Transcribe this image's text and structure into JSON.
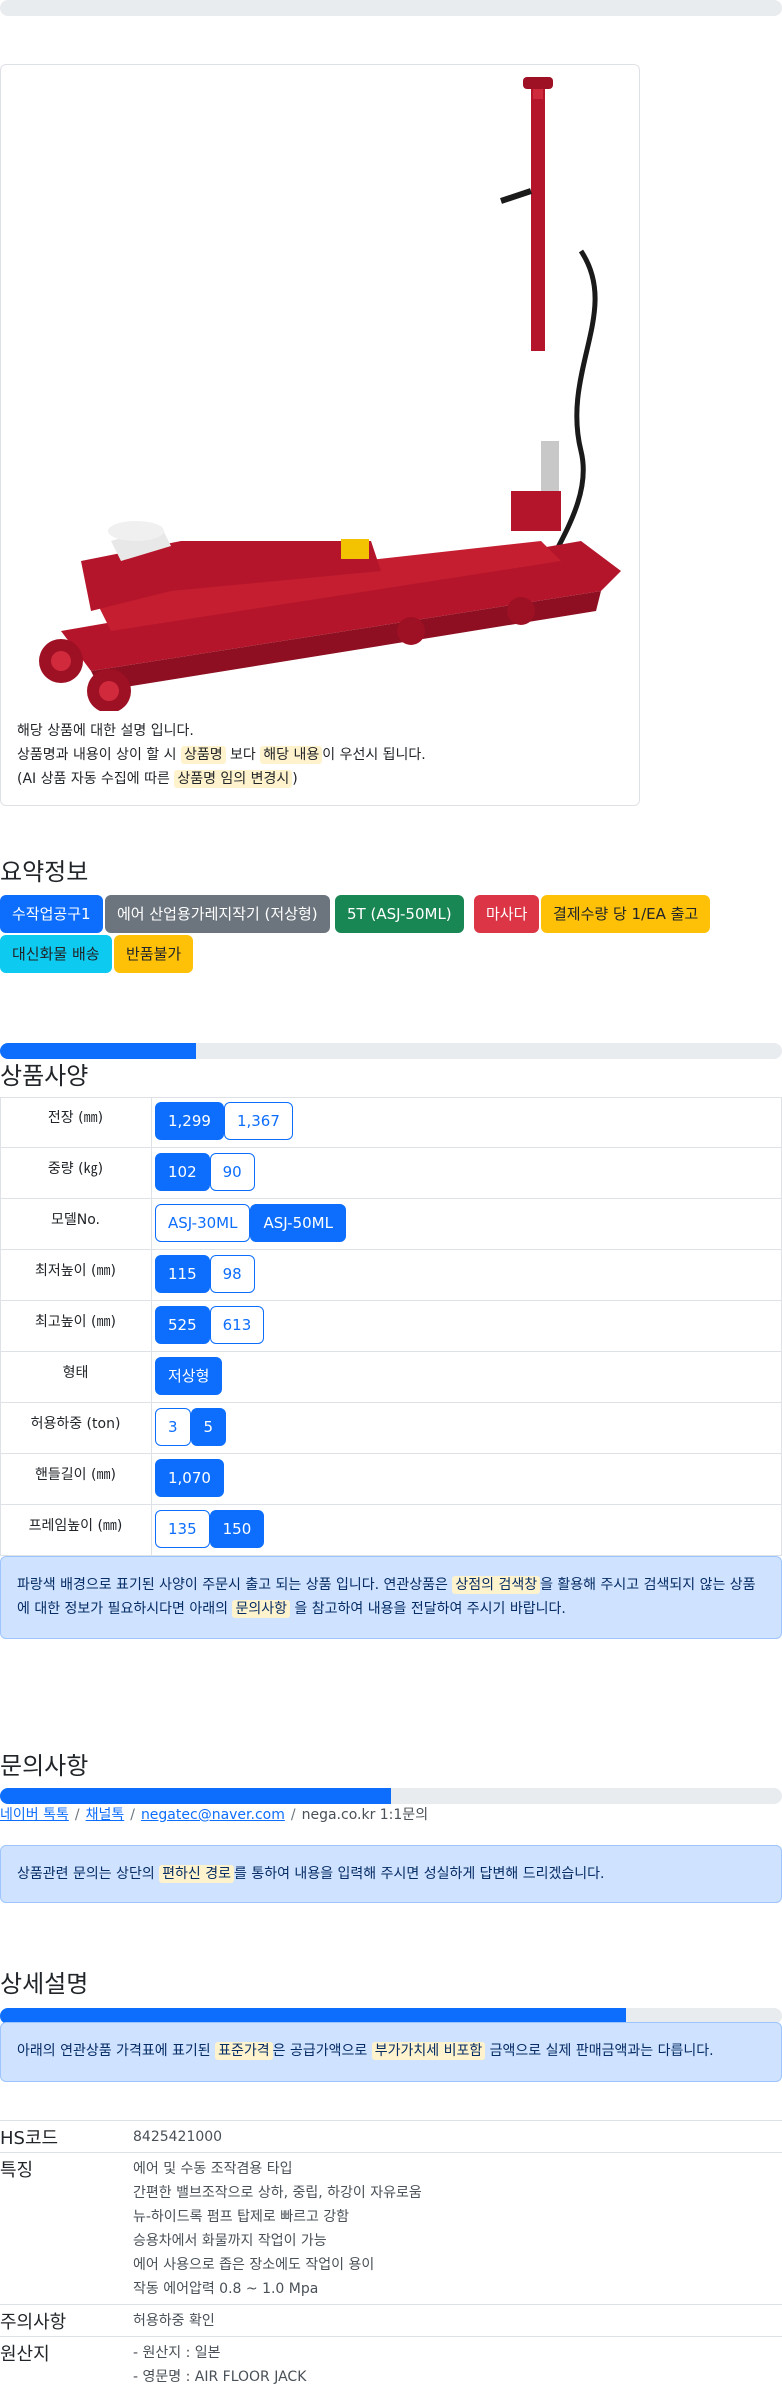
{
  "product": {
    "image_alt": "product-image",
    "desc_line1": "해당 상품에 대한 설명 입니다.",
    "desc_line2_a": "상품명과 내용이 상이 할 시 ",
    "desc_line2_hl1": "상품명",
    "desc_line2_b": " 보다 ",
    "desc_line2_hl2": "해당 내용",
    "desc_line2_c": "이 우선시 됩니다.",
    "desc_line3_a": "(AI 상품 자동 수집에 따른 ",
    "desc_line3_hl": "상품명 임의 변경시",
    "desc_line3_b": ")"
  },
  "summary": {
    "title": "요약정보",
    "badges": [
      "수작업공구1",
      "에어 산업용가레지작기 (저상형)",
      "5T (ASJ-50ML)",
      "마사다",
      "결제수량 당 1/EA 출고",
      "대신화물 배송",
      "반품불가"
    ]
  },
  "specs": {
    "title": "상품사양",
    "progress": 0.25,
    "rows": [
      {
        "label": "전장 (㎜)",
        "options": [
          "1,299",
          "1,367"
        ],
        "selected": [
          0
        ]
      },
      {
        "label": "중량 (㎏)",
        "options": [
          "102",
          "90"
        ],
        "selected": [
          0
        ]
      },
      {
        "label": "모델No.",
        "options": [
          "ASJ-30ML",
          "ASJ-50ML"
        ],
        "selected": [
          1
        ]
      },
      {
        "label": "최저높이 (㎜)",
        "options": [
          "115",
          "98"
        ],
        "selected": [
          0
        ]
      },
      {
        "label": "최고높이 (㎜)",
        "options": [
          "525",
          "613"
        ],
        "selected": [
          0
        ]
      },
      {
        "label": "형태",
        "options": [
          "저상형"
        ],
        "selected": [
          0
        ]
      },
      {
        "label": "허용하중 (ton)",
        "options": [
          "3",
          "5"
        ],
        "selected": [
          1
        ]
      },
      {
        "label": "핸들길이 (㎜)",
        "options": [
          "1,070"
        ],
        "selected": [
          0
        ]
      },
      {
        "label": "프레임높이 (㎜)",
        "options": [
          "135",
          "150"
        ],
        "selected": [
          1
        ]
      }
    ],
    "notice_a": "파랑색 배경으로 표기된 사양이 주문시 출고 되는 상품 입니다. 연관상품은 ",
    "notice_hl1": "상점의 검색창",
    "notice_b": "을 활용해 주시고 검색되지 않는 상품에 대한 정보가 필요하시다면 아래의 ",
    "notice_hl2": "문의사항",
    "notice_c": " 을 참고하여 내용을 전달하여 주시기 바랍니다."
  },
  "inquiry": {
    "title": "문의사항",
    "progress": 0.5,
    "link1": "네이버 톡톡",
    "link2": "채널톡",
    "link3": "negatec@naver.com",
    "text4": "nega.co.kr 1:1문의",
    "notice_a": "상품관련 문의는 상단의 ",
    "notice_hl": "편하신 경로",
    "notice_b": "를 통하여 내용을 입력해 주시면 성실하게 답변해 드리겠습니다."
  },
  "detail": {
    "title": "상세설명",
    "progress": 0.8,
    "notice_a": "아래의 연관상품 가격표에 표기된 ",
    "notice_hl1": "표준가격",
    "notice_b": "은 공급가액으로 ",
    "notice_hl2": "부가가치세 비포함",
    "notice_c": " 금액으로 실제 판매금액과는 다릅니다.",
    "rows": [
      {
        "key": "HS코드",
        "lines": [
          "8425421000"
        ]
      },
      {
        "key": "특징",
        "lines": [
          "에어 및 수동 조작겸용 타입",
          "간편한 밸브조작으로 상하, 중립, 하강이 자유로움",
          "뉴-하이드록 펌프 탑제로 빠르고 강함",
          "승용차에서 화물까지 작업이 가능",
          "에어 사용으로 좁은 장소에도 작업이 용이",
          "작동 에어압력 0.8 ~ 1.0 Mpa"
        ]
      },
      {
        "key": "주의사항",
        "lines": [
          "허용하중 확인"
        ]
      },
      {
        "key": "원산지",
        "lines": [
          "- 원산지 : 일본",
          "- 영문명 : AIR FLOOR JACK"
        ]
      }
    ]
  },
  "colors": {
    "primary": "#0d6efd",
    "jack_red": "#b5152b",
    "highlight": "#fff3cd",
    "alert_bg": "#cfe2ff"
  }
}
